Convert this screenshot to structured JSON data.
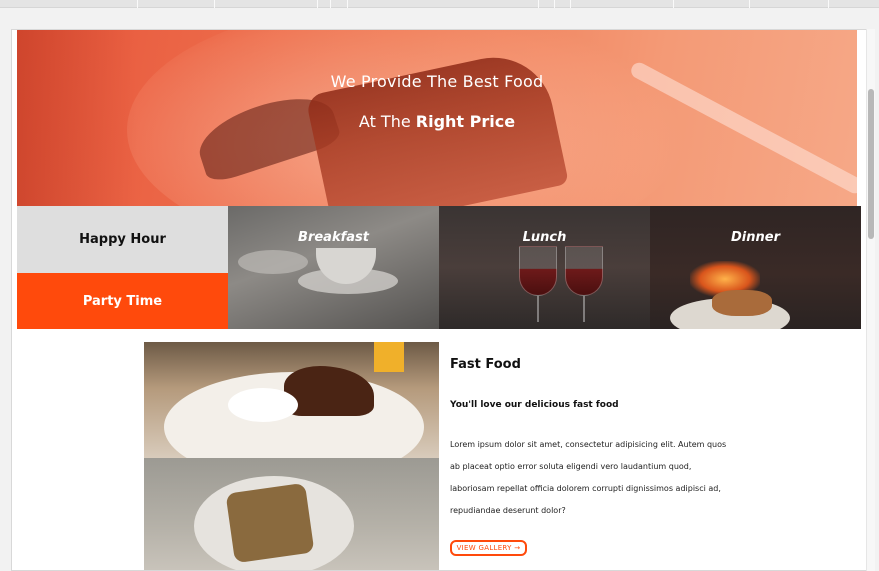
{
  "hero": {
    "line1": "We Provide The Best Food",
    "line2_prefix": "At The ",
    "line2_bold": "Right Price"
  },
  "side_buttons": {
    "happy_hour": "Happy Hour",
    "party_time": "Party Time"
  },
  "categories": [
    {
      "label": "Breakfast"
    },
    {
      "label": "Lunch"
    },
    {
      "label": "Dinner"
    }
  ],
  "feature": {
    "title": "Fast Food",
    "subtitle": "You'll love our delicious fast food",
    "body_lines": [
      "Lorem ipsum dolor sit amet, consectetur adipisicing elit. Autem quos",
      "ab placeat optio error soluta eligendi vero laudantium quod,",
      "laboriosam repellat officia dolorem corrupti dignissimos adipisci ad,",
      "repudiandae deserunt dolor?"
    ],
    "button": "VIEW GALLERY →"
  },
  "colors": {
    "accent": "#ff4a0c",
    "hero_tint": "#ef7a55",
    "happy_hour_bg": "#dedede"
  }
}
